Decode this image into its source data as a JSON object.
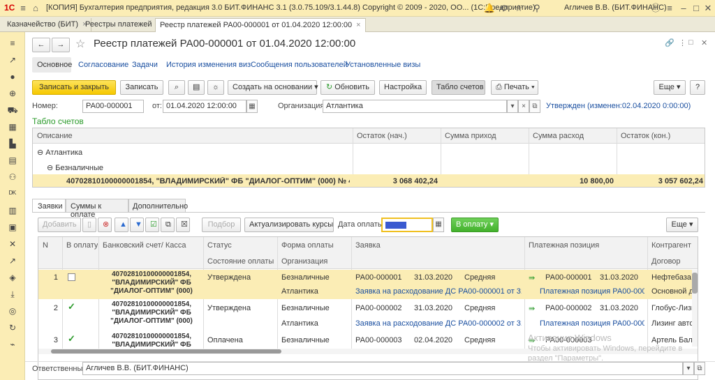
{
  "window": {
    "logo": "1С",
    "title": "[КОПИЯ] Бухгалтерия предприятия, редакция 3.0  БИТ.ФИНАНС 3.1 (3.0.75.109/3.1.44.8) Copyright © 2009 - 2020, ОО... (1С:Предприятие)",
    "user": "Агличев В.В. (БИТ.ФИНАНС)"
  },
  "tabs": [
    "Казначейство (БИТ)",
    "Реестры платежей",
    "Реестр платежей РА00-000001 от 01.04.2020 12:00:00"
  ],
  "doc": {
    "title": "Реестр платежей РА00-000001 от 01.04.2020 12:00:00"
  },
  "subnav": [
    "Основное",
    "Согласование",
    "Задачи",
    "История изменения виз",
    "Сообщения пользователей",
    "Установленные визы"
  ],
  "toolbar": {
    "save_close": "Записать и закрыть",
    "save": "Записать",
    "create_based": "Создать на основании",
    "refresh": "Обновить",
    "settings": "Настройка",
    "accounts_table": "Табло счетов",
    "print": "Печать",
    "more": "Еще",
    "help": "?"
  },
  "fields": {
    "number_label": "Номер:",
    "number": "РА00-000001",
    "date_label": "от:",
    "date": "01.04.2020 12:00:00",
    "org_label": "Организация:",
    "org": "Атлантика",
    "status": "Утвержден (изменен:02.04.2020 0:00:00)"
  },
  "accounts": {
    "section": "Табло счетов",
    "headers": [
      "Описание",
      "Остаток (нач.)",
      "Сумма приход",
      "Сумма расход",
      "Остаток (кон.)"
    ],
    "group": "Атлантика",
    "subgroup": "Безналичные",
    "row": {
      "desc": "40702810100000001854, \"ВЛАДИМИРСКИЙ\" ФБ \"ДИАЛОГ-ОПТИМ\" (000) № 4070281010...",
      "start": "3 068 402,24",
      "income": "",
      "expense": "10 800,00",
      "end": "3 057 602,24"
    }
  },
  "lowertabs": [
    "Заявки",
    "Суммы к оплате",
    "Дополнительно"
  ],
  "reqtoolbar": {
    "add": "Добавить",
    "selection": "Подбор",
    "update_rates": "Актуализировать курсы",
    "pay_date_label": "Дата оплаты:",
    "to_pay": "В оплату",
    "more": "Еще"
  },
  "reqgrid": {
    "headers": {
      "n": "N",
      "topay": "В оплату",
      "account": "Банковский счет/ Касса",
      "status": "Статус",
      "pay_state": "Состояние оплаты",
      "form": "Форма оплаты",
      "org": "Организация",
      "request": "Заявка",
      "position": "Платежная позиция",
      "counterparty": "Контрагент",
      "contract": "Договор"
    },
    "rows": [
      {
        "n": "1",
        "account": "40702810100000001854, \"ВЛАДИМИРСКИЙ\" ФБ \"ДИАЛОГ-ОПТИМ\" (000)",
        "status": "Утверждена",
        "form": "Безналичные",
        "org": "Атлантика",
        "req": "РА00-000001",
        "req_date": "31.03.2020",
        "priority": "Средняя",
        "req_link": "Заявка на расходование ДС РА00-000001 от 31.0...",
        "pos": "РА00-000001",
        "pos_date": "31.03.2020",
        "pos_link": "Платежная позиция РА00-000...",
        "cp": "Нефтебаза К",
        "contract": "Основной д"
      },
      {
        "n": "2",
        "account": "40702810100000001854, \"ВЛАДИМИРСКИЙ\" ФБ \"ДИАЛОГ-ОПТИМ\" (000)",
        "status": "Утверждена",
        "form": "Безналичные",
        "org": "Атлантика",
        "req": "РА00-000002",
        "req_date": "31.03.2020",
        "priority": "Средняя",
        "req_link": "Заявка на расходование ДС РА00-000002 от 31.0...",
        "pos": "РА00-000002",
        "pos_date": "31.03.2020",
        "pos_link": "Платежная позиция РА00-000...",
        "cp": "Глобус-Лизи",
        "contract": "Лизинг авто"
      },
      {
        "n": "3",
        "account": "40702810100000001854, \"ВЛАДИМИРСКИЙ\" ФБ",
        "status": "Оплачена",
        "form": "Безналичные",
        "org": "",
        "req": "РА00-000003",
        "req_date": "02.04.2020",
        "priority": "Средняя",
        "req_link": "",
        "pos": "РА00-000003",
        "pos_date": "",
        "pos_link": "",
        "cp": "Артель Балт",
        "contract": ""
      }
    ]
  },
  "watermark": {
    "line1": "Активация Windows",
    "line2": "Чтобы активировать Windows, перейдите в",
    "line3": "раздел \"Параметры\"."
  },
  "responsible": {
    "label": "Ответственный:",
    "value": "Агличев В.В. (БИТ.ФИНАНС)"
  }
}
